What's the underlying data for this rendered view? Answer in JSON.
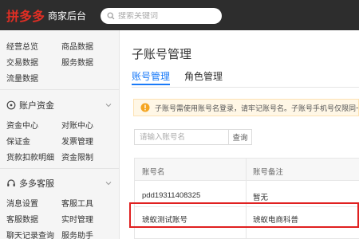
{
  "header": {
    "logo_mark": "拼多多",
    "logo_sub": "商家后台",
    "search_placeholder": "搜索关键词"
  },
  "sidebar": {
    "group1": [
      [
        "经营总览",
        "商品数据"
      ],
      [
        "交易数据",
        "服务数据"
      ],
      [
        "流量数据",
        ""
      ]
    ],
    "section2": {
      "title": "账户资金",
      "icon": "clock-icon"
    },
    "group2": [
      [
        "资金中心",
        "对账中心"
      ],
      [
        "保证金",
        "发票管理"
      ],
      [
        "货款扣款明细",
        "资金限制"
      ]
    ],
    "section3": {
      "title": "多多客服",
      "icon": "headset-icon"
    },
    "group3": [
      [
        "消息设置",
        "客服工具"
      ],
      [
        "客服数据",
        "实时管理"
      ],
      [
        "聊天记录查询",
        "服务助手"
      ]
    ]
  },
  "main": {
    "title": "子账号管理",
    "tabs": [
      {
        "label": "账号管理",
        "active": true
      },
      {
        "label": "角色管理",
        "active": false
      }
    ],
    "notice": "子账号需使用账号名登录，请牢记账号名。子账号手机号仅限同一",
    "search": {
      "placeholder": "请输入账号名",
      "button": "查询"
    },
    "table": {
      "headers": [
        "账号名",
        "账号备注"
      ],
      "rows": [
        [
          "pdd19311408325",
          "暂无"
        ],
        [
          "琥蚁测试账号",
          "琥蚁电商科普"
        ]
      ]
    }
  },
  "colors": {
    "brand": "#e02e24",
    "accent": "#1a7af8",
    "topbar": "#2d2d2d",
    "warn": "#f5a623",
    "highlight": "#e02020"
  }
}
